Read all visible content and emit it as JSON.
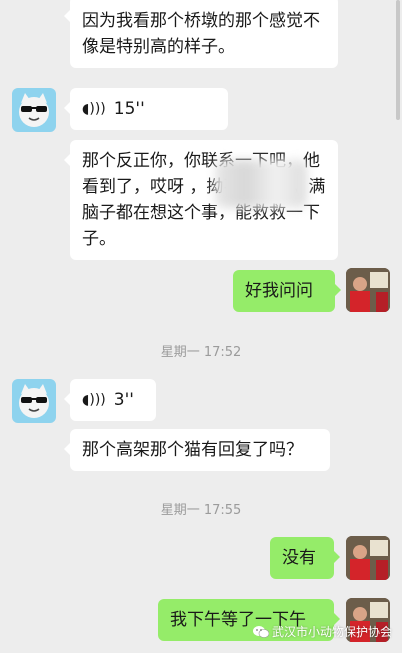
{
  "messages": {
    "m1": "因为我看那个桥墩的那个感觉不像是特别高的样子。",
    "voice1": "15''",
    "m2": "那个反正你，你联系一下吧，他看到了，哎呀              ，拗不过去呢，满脑子都在想这个事，能救救一下子。",
    "reply1": "好我问问",
    "ts1": "星期一 17:52",
    "voice2": "3''",
    "m3": "那个高架那个猫有回复了吗？",
    "ts2": "星期一 17:55",
    "reply2": "没有",
    "reply3": "我下午等了一下午"
  },
  "watermark": {
    "text": "武汉市小动物保护协会",
    "icon": "wechat-icon"
  },
  "colors": {
    "background": "#ededed",
    "incoming_bubble": "#ffffff",
    "outgoing_bubble": "#95ec69",
    "timestamp_text": "#9b9b9b"
  }
}
